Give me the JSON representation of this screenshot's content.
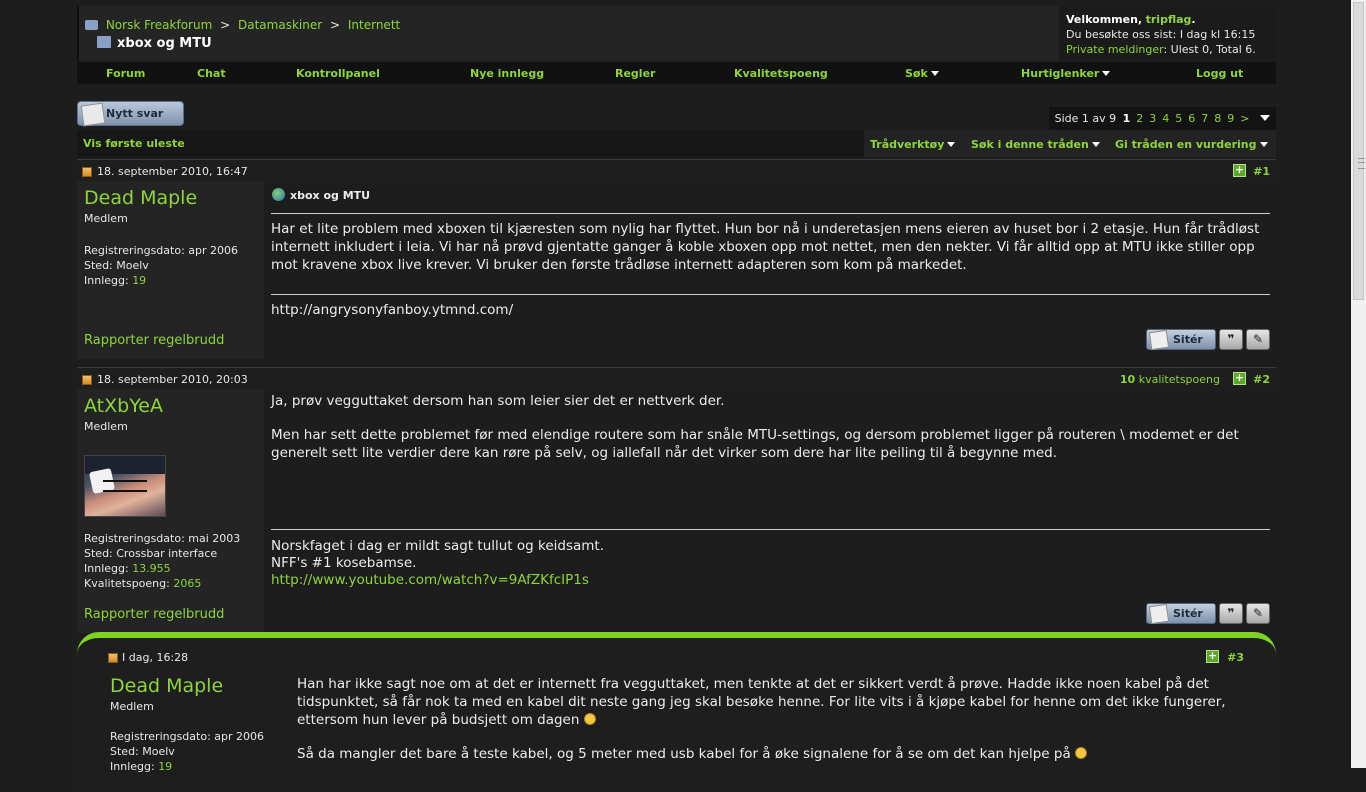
{
  "breadcrumb": {
    "items": [
      "Norsk Freakforum",
      "Datamaskiner",
      "Internett"
    ],
    "separator": ">"
  },
  "thread_title": "xbox og MTU",
  "welcome": {
    "greeting": "Velkommen,",
    "username": "tripflag",
    "last_visit": "Du besøkte oss sist: I dag kl 16:15",
    "pm_label": "Private meldinger",
    "pm_status": ": Ulest 0, Total 6."
  },
  "nav": {
    "forum": "Forum",
    "chat": "Chat",
    "control_panel": "Kontrollpanel",
    "new_posts": "Nye innlegg",
    "rules": "Regler",
    "quality_points": "Kvalitetspoeng",
    "search": "Søk",
    "quick_links": "Hurtiglenker",
    "logout": "Logg ut"
  },
  "reply_button": "Nytt svar",
  "pager": {
    "label": "Side 1 av 9",
    "current": "1",
    "pages": [
      "2",
      "3",
      "4",
      "5",
      "6",
      "7",
      "8",
      "9"
    ],
    "next": ">"
  },
  "thread_controls": {
    "first_unread": "Vis første uleste",
    "thread_tools": "Trådverktøy",
    "search_thread": "Søk i denne tråden",
    "rate_thread": "Gi tråden en vurdering"
  },
  "posts": [
    {
      "date": "18. september 2010, 16:47",
      "number": "#1",
      "username": "Dead Maple",
      "rank": "Medlem",
      "reg_date": "Registreringsdato: apr 2006",
      "location": "Sted: Moelv",
      "posts_label": "Innlegg:",
      "posts_value": "19",
      "title": "xbox og MTU",
      "text": "Har et lite problem med xboxen til kjæresten som nylig har flyttet. Hun bor nå i underetasjen mens eieren av huset bor i 2 etasje. Hun får trådløst internett inkludert i leia. Vi har nå prøvd gjentatte ganger å koble xboxen opp mot nettet, men den nekter. Vi får alltid opp at MTU ikke stiller opp mot kravene xbox live krever. Vi bruker den første trådløse internett adapteren som kom på markedet.",
      "signature": "http://angrysonyfanboy.ytmnd.com/",
      "report": "Rapporter regelbrudd",
      "quote_label": "Sitér"
    },
    {
      "date": "18. september 2010, 20:03",
      "number": "#2",
      "rep_value": "10",
      "rep_label": "kvalitetspoeng",
      "username": "AtXbYeA",
      "rank": "Medlem",
      "reg_date": "Registreringsdato: mai 2003",
      "location": "Sted: Crossbar interface",
      "posts_label": "Innlegg:",
      "posts_value": "13.955",
      "quality_label": "Kvalitetspoeng:",
      "quality_value": "2065",
      "text1": "Ja, prøv vegguttaket dersom han som leier sier det er nettverk der.",
      "text2": "Men har sett dette problemet før med elendige routere som har snåle MTU-settings, og dersom problemet ligger på routeren \\ modemet er det generelt sett lite verdier dere kan røre på selv, og iallefall når det virker som dere har lite peiling til å begynne med.",
      "sig1": "Norskfaget i dag er mildt sagt tullut og keidsamt.",
      "sig2": "NFF's #1 kosebamse.",
      "sig3": "http://www.youtube.com/watch?v=9AfZKfcIP1s",
      "report": "Rapporter regelbrudd",
      "quote_label": "Sitér"
    },
    {
      "date": "I dag, 16:28",
      "number": "#3",
      "username": "Dead Maple",
      "rank": "Medlem",
      "reg_date": "Registreringsdato: apr 2006",
      "location": "Sted: Moelv",
      "posts_label": "Innlegg:",
      "posts_value": "19",
      "text1": "Han har ikke sagt noe om at det er internett fra vegguttaket, men tenkte at det er sikkert verdt å prøve. Hadde ikke noen kabel på det tidspunktet, så får nok ta med en kabel dit neste gang jeg skal besøke henne. For lite vits i å kjøpe kabel for henne om det ikke fungerer, ettersom hun lever på budsjett om dagen",
      "text2": "Så da mangler det bare å teste kabel, og 5 meter med usb kabel for å øke signalene for å se om det kan hjelpe på"
    }
  ],
  "colors": {
    "accent": "#8fd53a",
    "highlight": "#7ed321",
    "background": "#1c1d1c"
  }
}
